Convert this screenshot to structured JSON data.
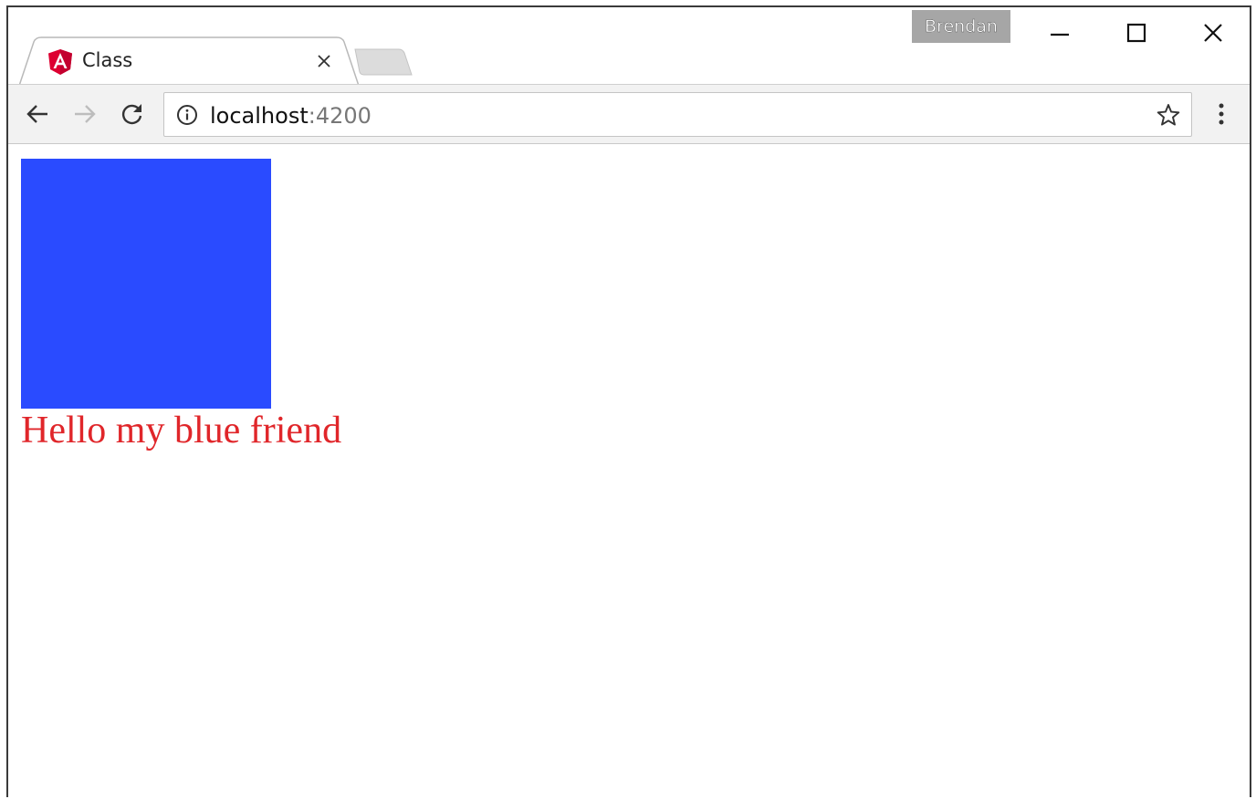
{
  "browser": {
    "tab": {
      "title": "Class",
      "favicon": "angular-logo-icon"
    },
    "profile": {
      "name": "Brendan"
    },
    "window_controls": {
      "minimize": "minimize-icon",
      "maximize": "maximize-icon",
      "close": "close-icon"
    },
    "address_bar": {
      "host": "localhost",
      "port": ":4200"
    }
  },
  "page": {
    "box_color": "#2a4bff",
    "greeting": "Hello my blue friend",
    "greeting_color": "#e0262a"
  },
  "colors": {
    "angular_red": "#dd0031",
    "profile_badge": "#a6a6a6",
    "toolbar_bg": "#f2f2f2"
  }
}
